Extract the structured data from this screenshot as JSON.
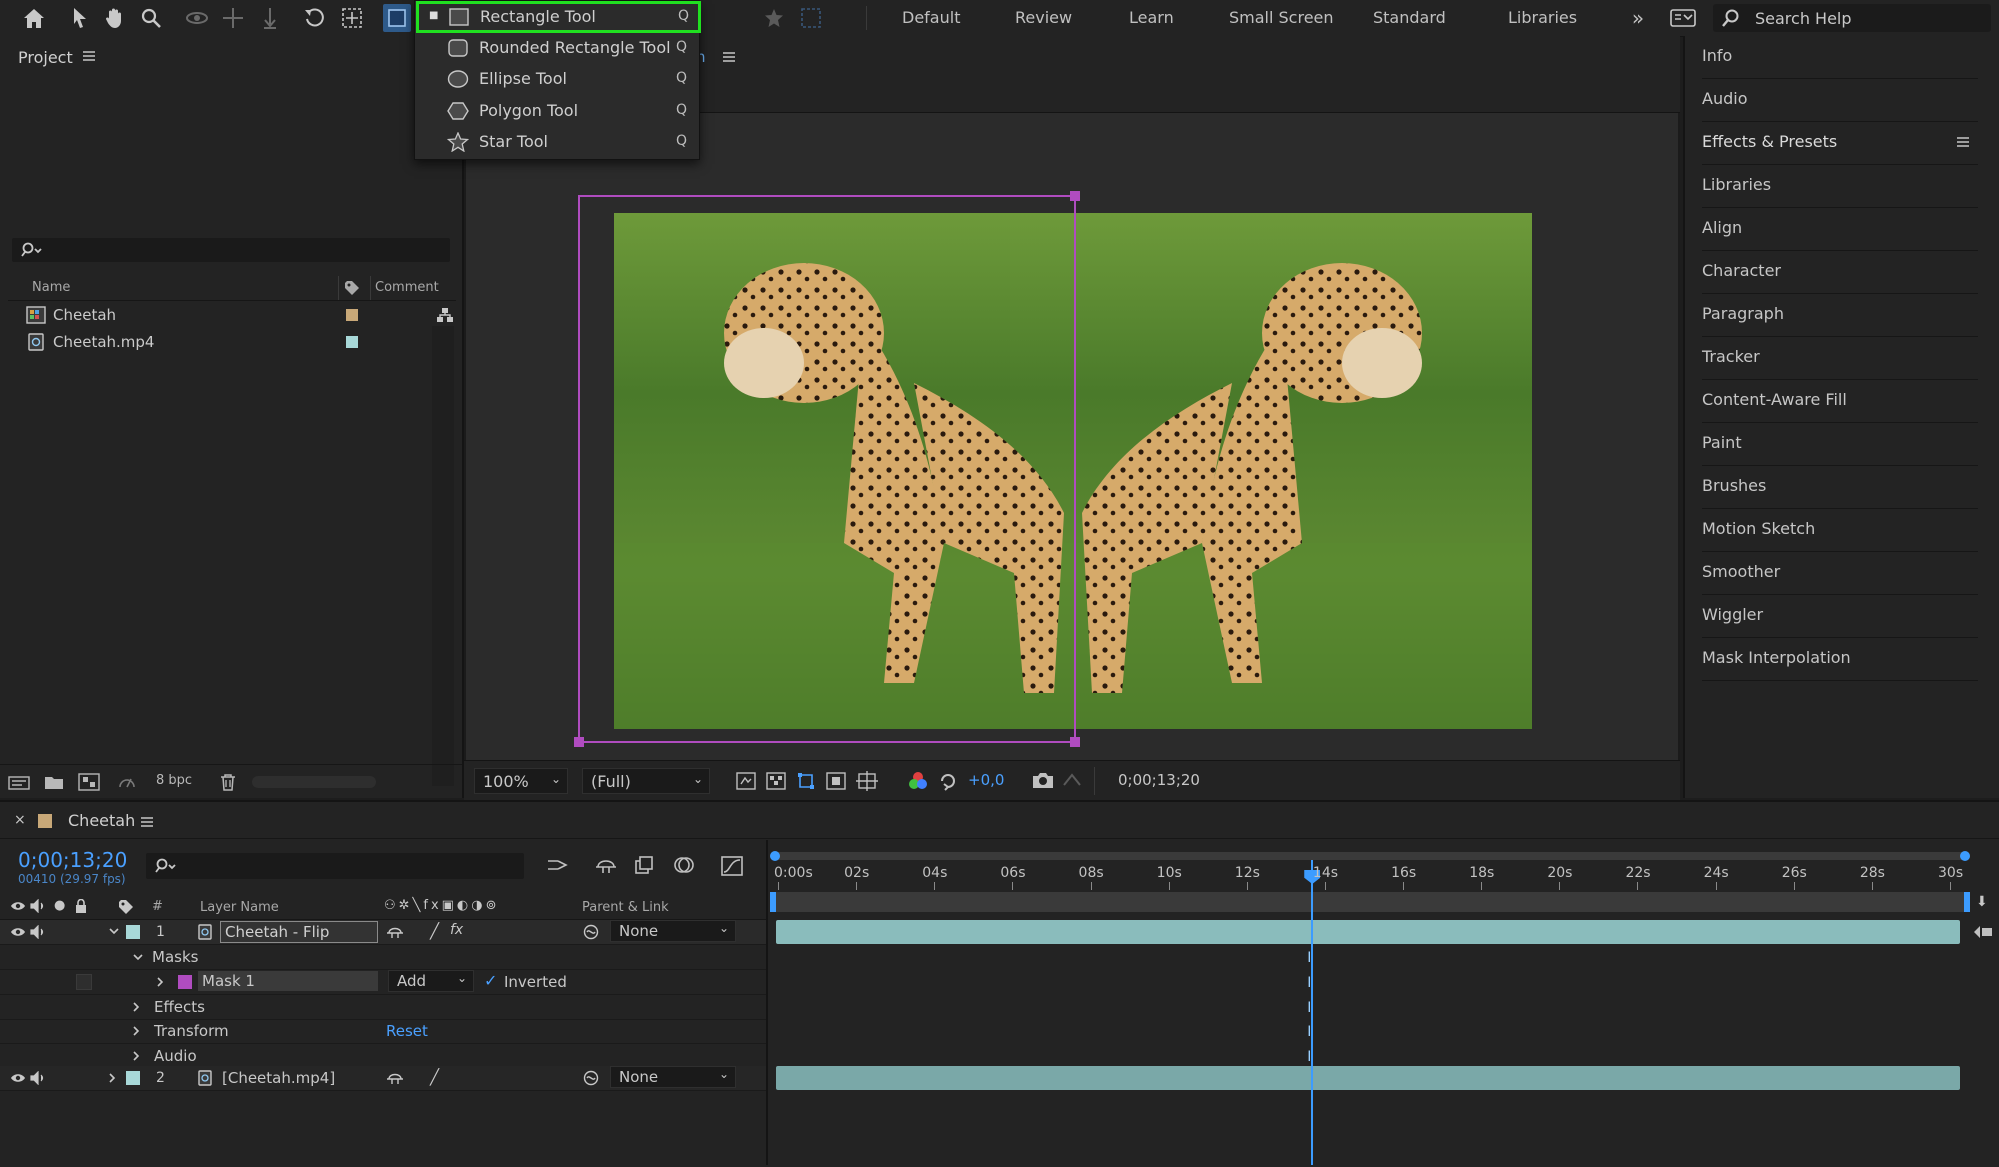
{
  "workspaces": [
    "Default",
    "Review",
    "Learn",
    "Small Screen",
    "Standard",
    "Libraries"
  ],
  "search_help": {
    "placeholder": "Search Help"
  },
  "tool_menu": {
    "items": [
      {
        "label": "Rectangle Tool",
        "key": "Q",
        "icon": "rectangle-icon",
        "selected": true
      },
      {
        "label": "Rounded Rectangle Tool",
        "key": "Q",
        "icon": "rounded-rectangle-icon"
      },
      {
        "label": "Ellipse Tool",
        "key": "Q",
        "icon": "ellipse-icon"
      },
      {
        "label": "Polygon Tool",
        "key": "Q",
        "icon": "polygon-icon"
      },
      {
        "label": "Star Tool",
        "key": "Q",
        "icon": "star-icon"
      }
    ]
  },
  "project": {
    "title": "Project",
    "columns": {
      "name": "Name",
      "comment": "Comment"
    },
    "items": [
      {
        "name": "Cheetah",
        "color": "#c8a878"
      },
      {
        "name": "Cheetah.mp4",
        "color": "#a8d8d8"
      }
    ],
    "bpc": "8 bpc"
  },
  "viewer": {
    "comp_tab_fragment": "h",
    "zoom": "100%",
    "resolution": "(Full)",
    "exposure": "+0,0",
    "timecode": "0;00;13;20"
  },
  "right_panels": [
    "Info",
    "Audio",
    "Effects & Presets",
    "Libraries",
    "Align",
    "Character",
    "Paragraph",
    "Tracker",
    "Content-Aware Fill",
    "Paint",
    "Brushes",
    "Motion Sketch",
    "Smoother",
    "Wiggler",
    "Mask Interpolation"
  ],
  "timeline": {
    "comp_name": "Cheetah",
    "current_time": "0;00;13;20",
    "frame_info": "00410 (29.97 fps)",
    "columns": {
      "num": "#",
      "layer_name": "Layer Name",
      "parent": "Parent & Link"
    },
    "ruler": [
      "0:00s",
      "02s",
      "04s",
      "06s",
      "08s",
      "10s",
      "12s",
      "14s",
      "16s",
      "18s",
      "20s",
      "22s",
      "24s",
      "26s",
      "28s",
      "30s"
    ],
    "layers": [
      {
        "num": "1",
        "name": "Cheetah - Flip",
        "parent": "None",
        "color": "#a8d8d8"
      },
      {
        "num": "2",
        "name": "[Cheetah.mp4]",
        "parent": "None",
        "color": "#a8d8d8"
      }
    ],
    "masks_label": "Masks",
    "mask": {
      "name": "Mask 1",
      "mode": "Add",
      "inverted_label": "Inverted",
      "color": "#b04cc0"
    },
    "effects_label": "Effects",
    "transform_label": "Transform",
    "reset_label": "Reset",
    "audio_label": "Audio",
    "playhead_fraction": 0.455
  },
  "colors": {
    "accent": "#3c9cff",
    "mask_path": "#b04cc0",
    "highlight": "#20e020"
  }
}
